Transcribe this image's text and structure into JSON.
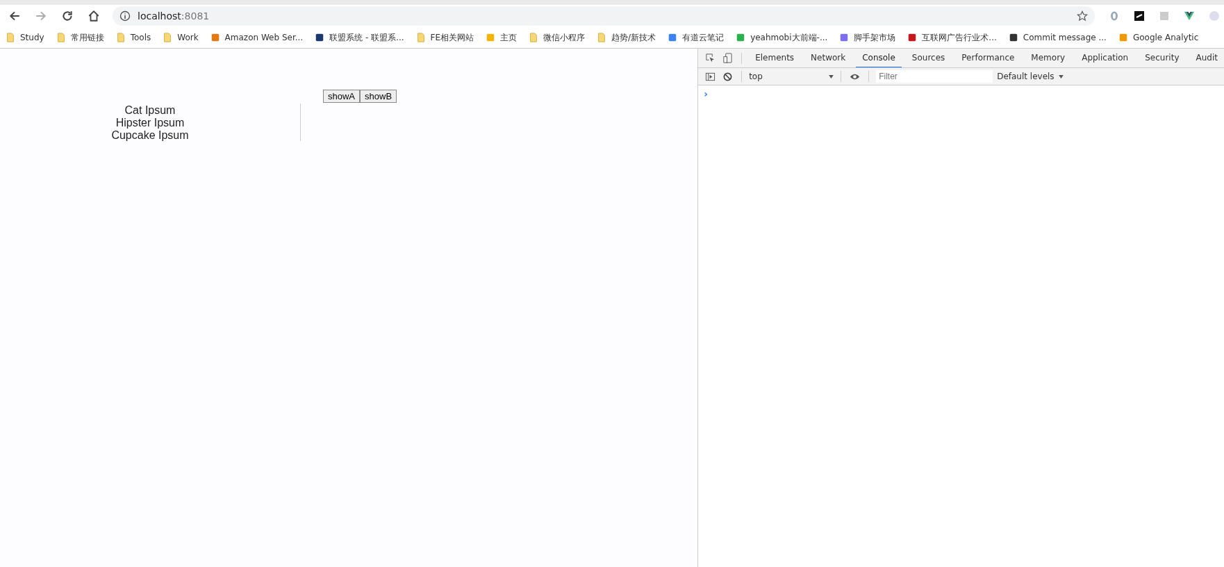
{
  "browser": {
    "address": {
      "host": "localhost",
      "port": ":8081"
    }
  },
  "bookmarks": [
    {
      "label": "Study",
      "kind": "folder"
    },
    {
      "label": "常用链接",
      "kind": "folder"
    },
    {
      "label": "Tools",
      "kind": "folder"
    },
    {
      "label": "Work",
      "kind": "folder"
    },
    {
      "label": "Amazon Web Ser...",
      "kind": "cube"
    },
    {
      "label": "联盟系统 - 联盟系...",
      "kind": "cross"
    },
    {
      "label": "FE相关网站",
      "kind": "folder"
    },
    {
      "label": "主页",
      "kind": "fork"
    },
    {
      "label": "微信小程序",
      "kind": "folder"
    },
    {
      "label": "趋势/新技术",
      "kind": "folder"
    },
    {
      "label": "有道云笔记",
      "kind": "note"
    },
    {
      "label": "yeahmobi大前端-...",
      "kind": "grid"
    },
    {
      "label": "脚手架市场",
      "kind": "hash"
    },
    {
      "label": "互联网广告行业术...",
      "kind": "letter"
    },
    {
      "label": "Commit message ...",
      "kind": "brush"
    },
    {
      "label": "Google Analytic",
      "kind": "bars"
    }
  ],
  "page": {
    "list": [
      "Cat Ipsum",
      "Hipster Ipsum",
      "Cupcake Ipsum"
    ],
    "buttons": [
      "showA",
      "showB"
    ]
  },
  "devtools": {
    "tabs": [
      {
        "label": "Elements",
        "selected": false
      },
      {
        "label": "Network",
        "selected": false
      },
      {
        "label": "Console",
        "selected": true
      },
      {
        "label": "Sources",
        "selected": false
      },
      {
        "label": "Performance",
        "selected": false
      },
      {
        "label": "Memory",
        "selected": false
      },
      {
        "label": "Application",
        "selected": false
      },
      {
        "label": "Security",
        "selected": false
      },
      {
        "label": "Audit",
        "selected": false
      }
    ],
    "context": "top",
    "filter": {
      "placeholder": "Filter"
    },
    "levels": "Default levels",
    "prompt": "›"
  }
}
